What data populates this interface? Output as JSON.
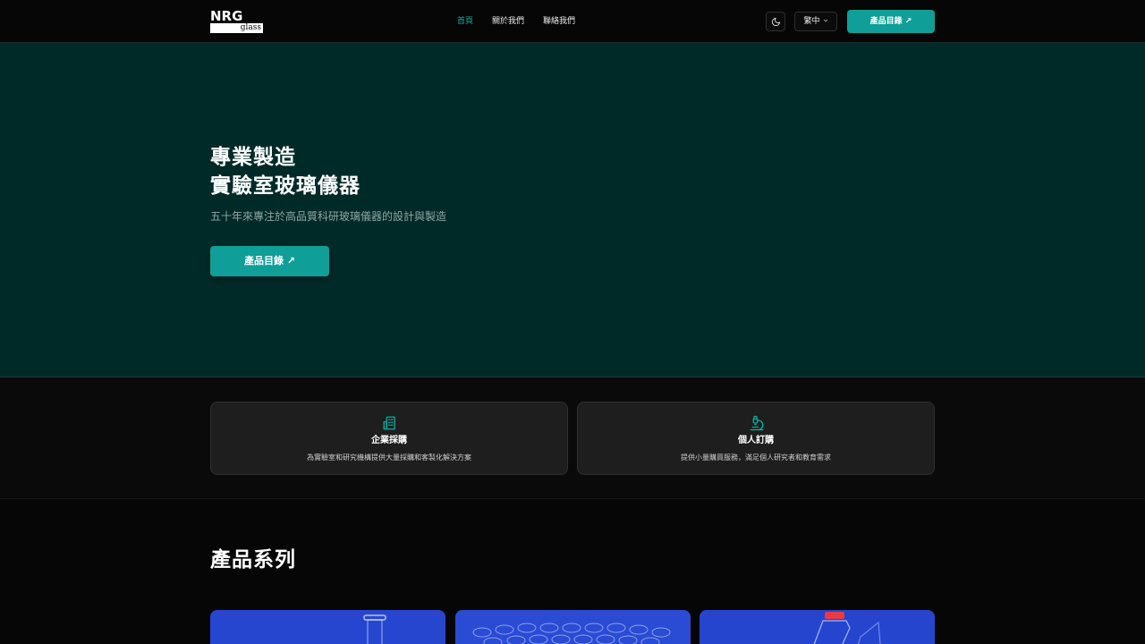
{
  "brand": {
    "logo_top": "NRG",
    "logo_bottom": "glass"
  },
  "nav": {
    "items": [
      {
        "label": "首頁",
        "active": true
      },
      {
        "label": "關於我們",
        "active": false
      },
      {
        "label": "聯絡我們",
        "active": false
      }
    ]
  },
  "header": {
    "theme_icon": "moon-icon",
    "language": "繁中",
    "catalog_label": "產品目錄 ↗"
  },
  "hero": {
    "title_line1": "專業製造",
    "title_line2": "實驗室玻璃儀器",
    "subtitle": "五十年來專注於高品質科研玻璃儀器的設計與製造",
    "button_label": "產品目錄 ↗"
  },
  "cards": [
    {
      "icon": "building-icon",
      "title": "企業採購",
      "description": "為實驗室和研究機構提供大量採購和客製化解決方案"
    },
    {
      "icon": "microscope-icon",
      "title": "個人訂購",
      "description": "提供小量購買服務，滿足個人研究者和教育需求"
    }
  ],
  "products": {
    "section_title": "產品系列"
  },
  "colors": {
    "accent": "#0f9e98",
    "hero_bg": "#002a28",
    "page_bg": "#060606",
    "card_bg": "#1e1e1e"
  }
}
